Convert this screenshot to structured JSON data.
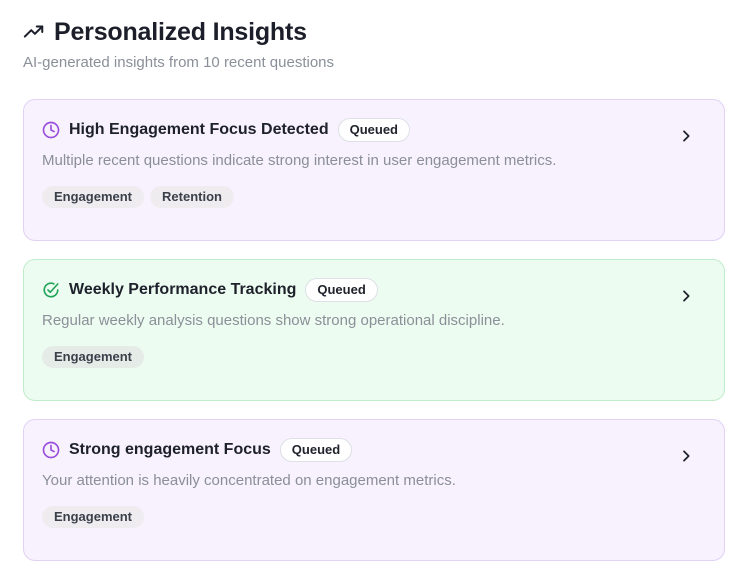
{
  "header": {
    "title": "Personalized Insights",
    "subtitle": "AI-generated insights from 10 recent questions",
    "icon": "trending-up-icon"
  },
  "colors": {
    "purple_icon": "#9b4ddb",
    "green_icon": "#22a45a",
    "purple_bg": "#f7f2fd",
    "green_bg": "#edfcf1"
  },
  "insights": [
    {
      "title": "High Engagement Focus Detected",
      "badge": "Queued",
      "description": "Multiple recent questions indicate strong interest in user engagement metrics.",
      "tags": [
        "Engagement",
        "Retention"
      ],
      "icon": "clock-icon",
      "theme": "purple"
    },
    {
      "title": "Weekly Performance Tracking",
      "badge": "Queued",
      "description": "Regular weekly analysis questions show strong operational discipline.",
      "tags": [
        "Engagement"
      ],
      "icon": "check-circle-icon",
      "theme": "green"
    },
    {
      "title": "Strong engagement Focus",
      "badge": "Queued",
      "description": "Your attention is heavily concentrated on engagement metrics.",
      "tags": [
        "Engagement"
      ],
      "icon": "clock-icon",
      "theme": "purple"
    }
  ]
}
